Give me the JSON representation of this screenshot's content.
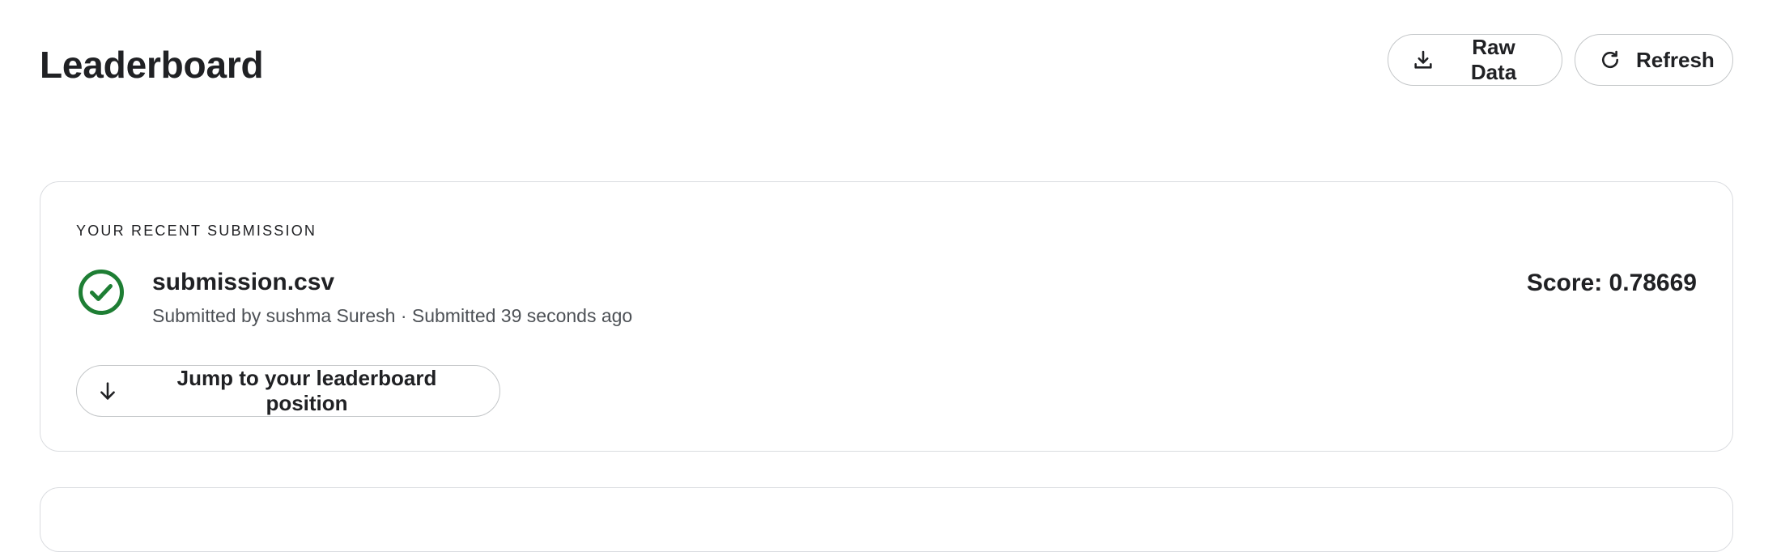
{
  "header": {
    "title": "Leaderboard",
    "raw_data_label": "Raw Data",
    "refresh_label": "Refresh"
  },
  "recent_submission": {
    "section_label": "YOUR RECENT SUBMISSION",
    "status": "complete",
    "status_icon": "check-circle-icon",
    "status_color": "#1e7e34",
    "file_name": "submission.csv",
    "meta": "Submitted by sushma Suresh · Submitted 39 seconds ago",
    "score": "Score: 0.78669",
    "jump_label": "Jump to your leaderboard position"
  },
  "icons": {
    "raw_data": "download-icon",
    "refresh": "refresh-icon",
    "jump": "arrow-down-icon"
  }
}
